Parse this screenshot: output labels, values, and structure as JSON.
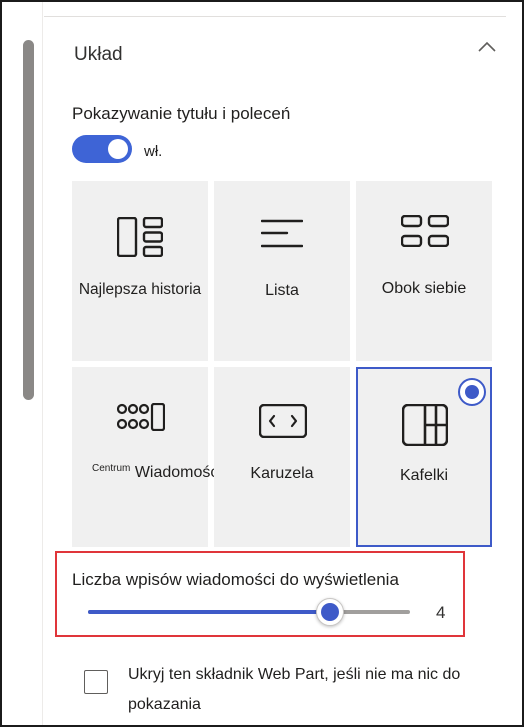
{
  "section": {
    "title": "Układ"
  },
  "show_title": {
    "label": "Pokazywanie tytułu i poleceń",
    "state": "wł."
  },
  "layouts": [
    {
      "label": "Najlepsza historia",
      "icon": "top-story-layout-icon",
      "selected": false
    },
    {
      "label": "Lista",
      "icon": "list-layout-icon",
      "selected": false
    },
    {
      "label": "Obok siebie",
      "icon": "side-by-side-layout-icon",
      "selected": false
    },
    {
      "label_small": "Centrum",
      "label": "Wiadomości",
      "icon": "news-hub-layout-icon",
      "selected": false
    },
    {
      "label": "Karuzela",
      "icon": "carousel-layout-icon",
      "selected": false
    },
    {
      "label": "Kafelki",
      "icon": "tiles-layout-icon",
      "selected": true
    }
  ],
  "slider": {
    "label": "Liczba wpisów wiadomości do wyświetlenia",
    "value": "4",
    "fill_fraction": 0.75
  },
  "hide_webpart": {
    "label": "Ukryj ten składnik Web Part, jeśli nie ma nic do pokazania",
    "checked": false
  },
  "colors": {
    "accent": "#3e5ac8",
    "highlight": "#e0353a",
    "tile_background": "#f0f0f0"
  }
}
